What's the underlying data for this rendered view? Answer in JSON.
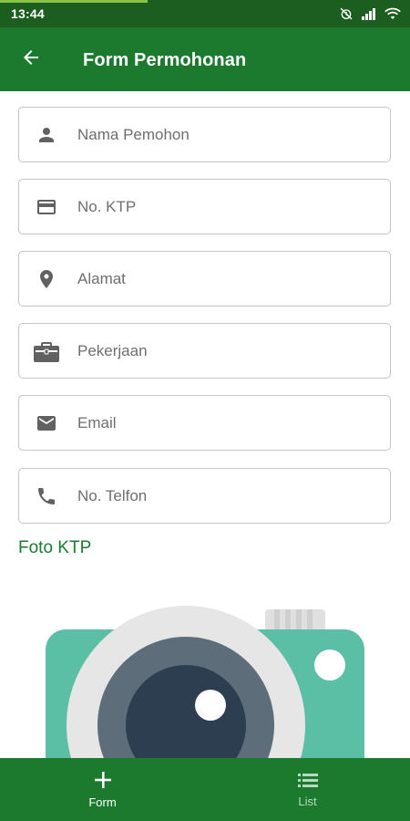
{
  "status_bar": {
    "time": "13:44",
    "progress_fraction": 0.36
  },
  "app_bar": {
    "title": "Form Permohonan"
  },
  "form": {
    "fields": [
      {
        "icon": "person-icon",
        "placeholder": "Nama Pemohon",
        "value": ""
      },
      {
        "icon": "id-card-icon",
        "placeholder": "No. KTP",
        "value": ""
      },
      {
        "icon": "location-pin-icon",
        "placeholder": "Alamat",
        "value": ""
      },
      {
        "icon": "briefcase-icon",
        "placeholder": "Pekerjaan",
        "value": ""
      },
      {
        "icon": "mail-icon",
        "placeholder": "Email",
        "value": ""
      },
      {
        "icon": "phone-icon",
        "placeholder": "No. Telfon",
        "value": ""
      }
    ],
    "photo_label": "Foto KTP",
    "photo_icon": "camera-icon"
  },
  "bottom_nav": {
    "items": [
      {
        "label": "Form",
        "icon": "plus-icon",
        "active": true
      },
      {
        "label": "List",
        "icon": "list-icon",
        "active": false
      }
    ]
  },
  "colors": {
    "status_bar": "#1b5e20",
    "primary": "#1b7a2e",
    "accent_text": "#1b7a2e",
    "icon_gray": "#616161",
    "camera_body": "#5bbfa6",
    "camera_lens_ring": "#e6e6e6",
    "camera_lens_mid": "#5d6d7a",
    "camera_lens_inner": "#2c3e50"
  }
}
